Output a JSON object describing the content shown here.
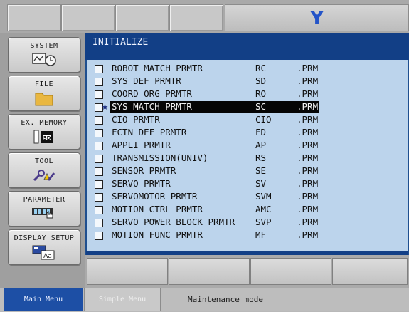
{
  "brand": {
    "logo": "Y"
  },
  "panel": {
    "title": "INITIALIZE"
  },
  "sidebar": {
    "buttons": [
      {
        "label": "SYSTEM",
        "icon": "system-monitor-icon"
      },
      {
        "label": "FILE",
        "icon": "folder-icon"
      },
      {
        "label": "EX. MEMORY",
        "icon": "sd-card-icon"
      },
      {
        "label": "TOOL",
        "icon": "tool-wrench-icon"
      },
      {
        "label": "PARAMETER",
        "icon": "parameter-hand-icon"
      },
      {
        "label": "DISPLAY SETUP",
        "icon": "display-font-icon"
      }
    ]
  },
  "files": [
    {
      "name": "ROBOT MATCH PRMTR",
      "code": "RC",
      "ext": ".PRM",
      "selected": false
    },
    {
      "name": "SYS DEF PRMTR",
      "code": "SD",
      "ext": ".PRM",
      "selected": false
    },
    {
      "name": "COORD ORG PRMTR",
      "code": "RO",
      "ext": ".PRM",
      "selected": false
    },
    {
      "name": "SYS MATCH PRMTR",
      "code": "SC",
      "ext": ".PRM",
      "selected": true
    },
    {
      "name": "CIO PRMTR",
      "code": "CIO",
      "ext": ".PRM",
      "selected": false
    },
    {
      "name": "FCTN DEF PRMTR",
      "code": "FD",
      "ext": ".PRM",
      "selected": false
    },
    {
      "name": "APPLI PRMTR",
      "code": "AP",
      "ext": ".PRM",
      "selected": false
    },
    {
      "name": "TRANSMISSION(UNIV)",
      "code": "RS",
      "ext": ".PRM",
      "selected": false
    },
    {
      "name": "SENSOR PRMTR",
      "code": "SE",
      "ext": ".PRM",
      "selected": false
    },
    {
      "name": "SERVO PRMTR",
      "code": "SV",
      "ext": ".PRM",
      "selected": false
    },
    {
      "name": "SERVOMOTOR PRMTR",
      "code": "SVM",
      "ext": ".PRM",
      "selected": false
    },
    {
      "name": "MOTION CTRL PRMTR",
      "code": "AMC",
      "ext": ".PRM",
      "selected": false
    },
    {
      "name": "SERVO POWER BLOCK PRMTR",
      "code": "SVP",
      "ext": ".PRM",
      "selected": false
    },
    {
      "name": "MOTION FUNC PRMTR",
      "code": "MF",
      "ext": ".PRM",
      "selected": false
    }
  ],
  "status": {
    "main_menu": "Main Menu",
    "simple_menu": "Simple Menu",
    "mode": "Maintenance mode"
  },
  "colors": {
    "accent": "#123f86",
    "panel_bg": "#bcd4ec",
    "logo": "#2454c8"
  }
}
